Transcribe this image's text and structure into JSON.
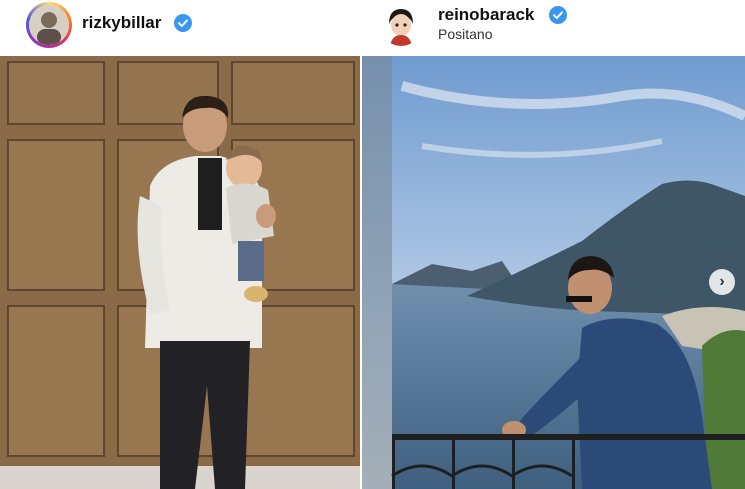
{
  "posts": [
    {
      "username": "rizkybillar",
      "verified": true,
      "location": "",
      "avatar": "story-ring-avatar",
      "photo": "man-holding-baby-wooden-wall"
    },
    {
      "username": "reinobarack",
      "verified": true,
      "location": "Positano",
      "avatar": "cartoon-avatar",
      "photo": "man-balcony-coast-view",
      "carousel_next_icon": "chevron-right-icon"
    }
  ],
  "colors": {
    "verified": "#3897f0",
    "username": "#111111",
    "location": "#333333"
  }
}
